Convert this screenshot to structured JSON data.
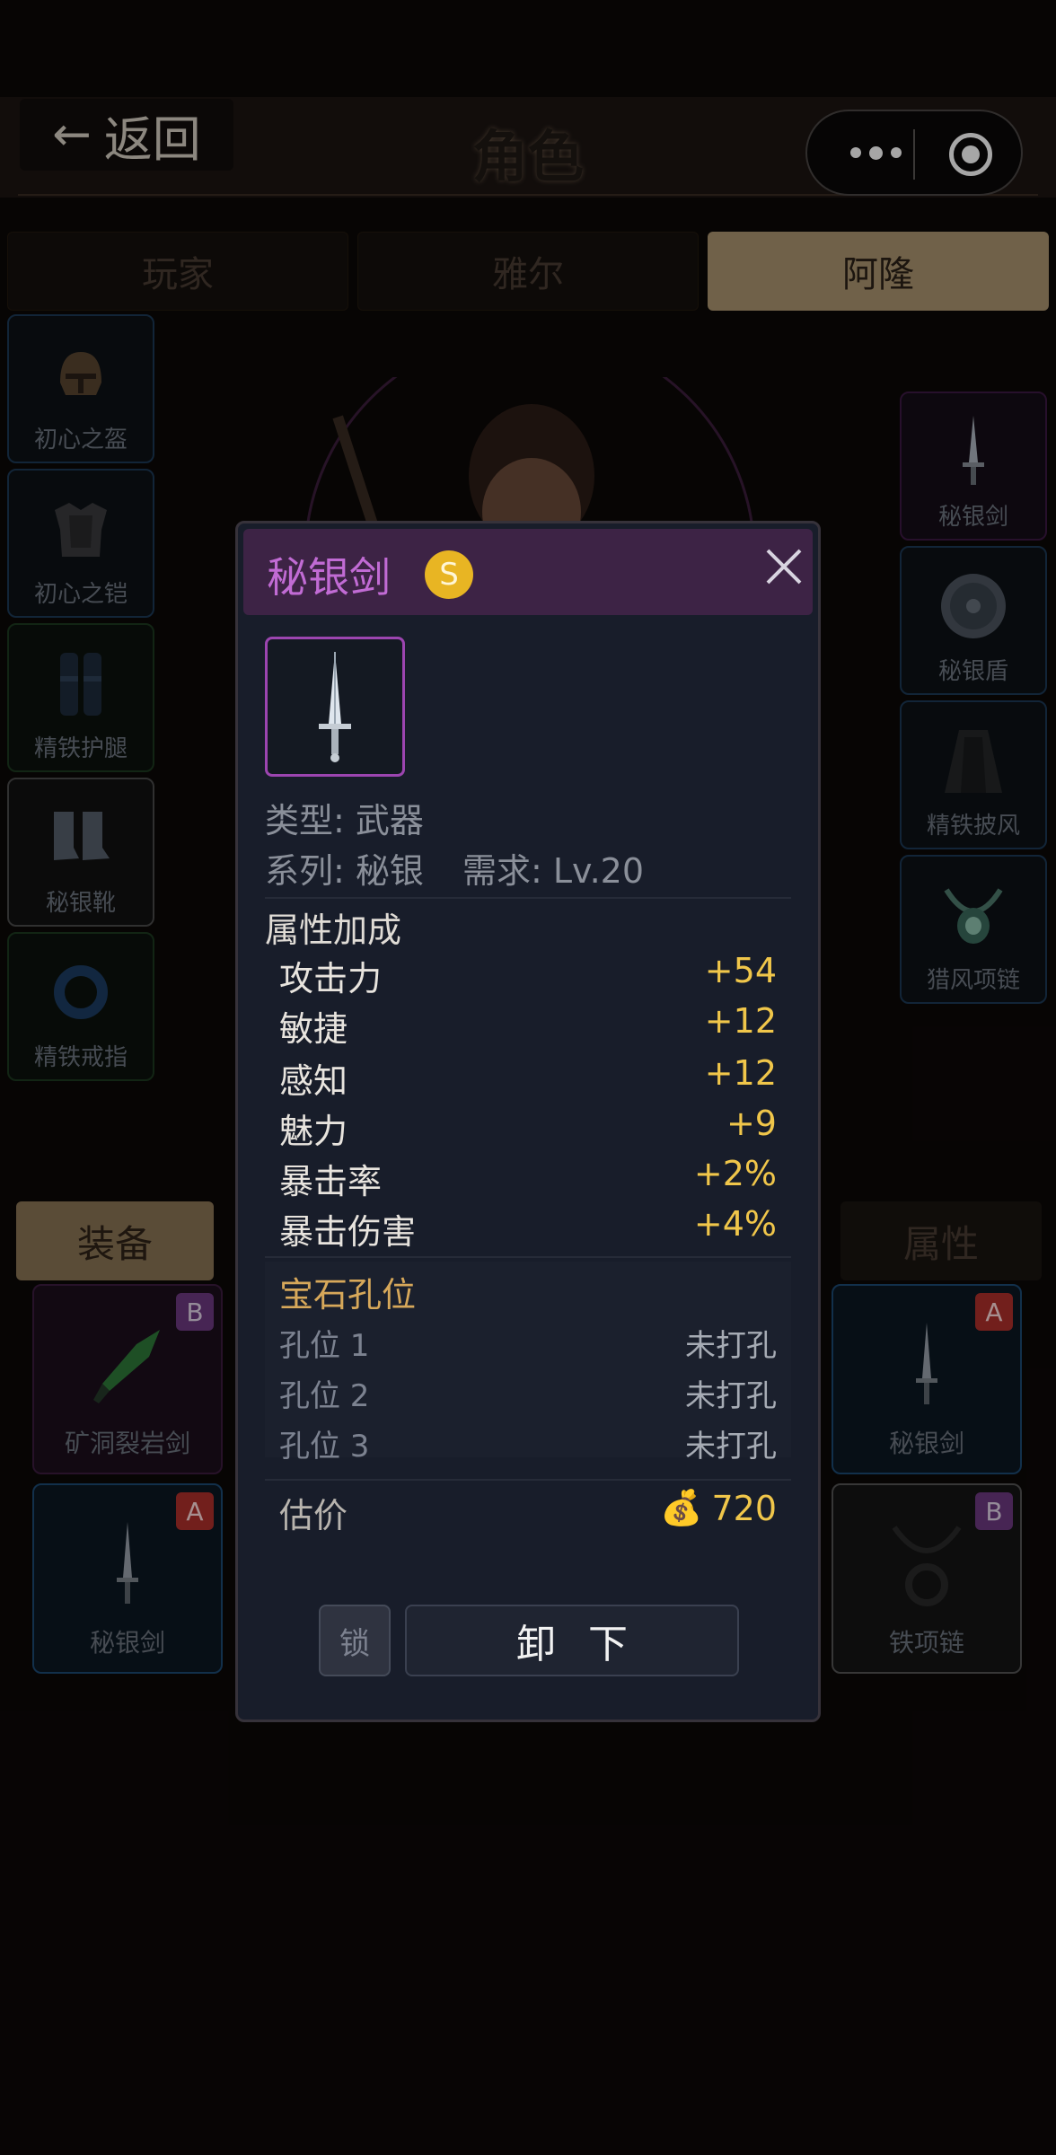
{
  "header": {
    "back_label": "返回",
    "title": "角色"
  },
  "tabs": [
    {
      "label": "玩家",
      "active": false
    },
    {
      "label": "雅尔",
      "active": false
    },
    {
      "label": "阿隆",
      "active": true
    }
  ],
  "left_slots": [
    {
      "name": "初心之盔",
      "icon": "helmet-icon"
    },
    {
      "name": "初心之铠",
      "icon": "armor-icon"
    },
    {
      "name": "精铁护腿",
      "icon": "leggings-icon"
    },
    {
      "name": "秘银靴",
      "icon": "boots-icon"
    },
    {
      "name": "精铁戒指",
      "icon": "ring-icon"
    }
  ],
  "right_slots": [
    {
      "name": "秘银剑",
      "icon": "sword-icon"
    },
    {
      "name": "秘银盾",
      "icon": "shield-icon"
    },
    {
      "name": "精铁披风",
      "icon": "cloak-icon"
    },
    {
      "name": "猎风项链",
      "icon": "necklace-icon"
    }
  ],
  "bottom_tabs": {
    "equip": "装备",
    "attributes": "属性"
  },
  "inventory": [
    {
      "name": "矿洞裂岩剑",
      "grade": "B",
      "icon": "green-blade-icon"
    },
    {
      "name": "秘银剑",
      "grade": "A",
      "icon": "sword-icon"
    },
    {
      "name": "秘银剑",
      "grade": "A",
      "icon": "sword-icon"
    },
    {
      "name": "铁项链",
      "grade": "B",
      "icon": "necklace-icon"
    }
  ],
  "modal": {
    "name": "秘银剑",
    "grade": "S",
    "type_line": "类型: 武器",
    "series_line": "系列: 秘银",
    "req_line": "需求: Lv.20",
    "attr_title": "属性加成",
    "stats": [
      {
        "label": "攻击力",
        "value": "+54"
      },
      {
        "label": "敏捷",
        "value": "+12"
      },
      {
        "label": "感知",
        "value": "+12"
      },
      {
        "label": "魅力",
        "value": "+9"
      },
      {
        "label": "暴击率",
        "value": "+2%"
      },
      {
        "label": "暴击伤害",
        "value": "+4%"
      }
    ],
    "gem_title": "宝石孔位",
    "sockets": [
      {
        "label": "孔位 1",
        "value": "未打孔"
      },
      {
        "label": "孔位 2",
        "value": "未打孔"
      },
      {
        "label": "孔位 3",
        "value": "未打孔"
      }
    ],
    "price_label": "估价",
    "price_icon": "💰",
    "price_value": "720",
    "lock_label": "锁",
    "unequip_label": "卸下"
  },
  "colors": {
    "accent_gold": "#ac9670",
    "stat_value": "#f0c64a",
    "item_name": "#c16bd4",
    "grade_s": "#e8b523"
  }
}
